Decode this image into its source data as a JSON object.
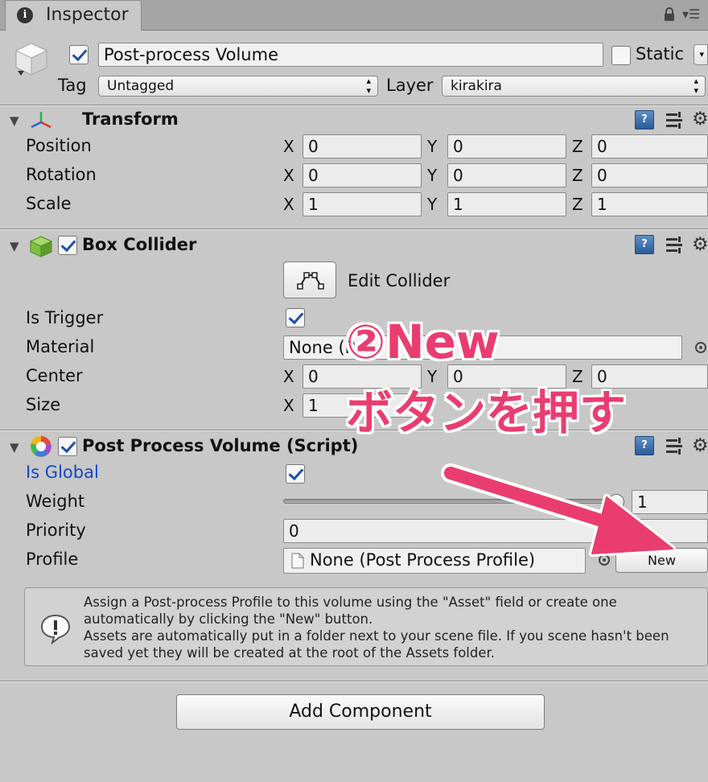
{
  "window": {
    "tab_label": "Inspector"
  },
  "header": {
    "object_name": "Post-process Volume",
    "static_label": "Static",
    "tag_label": "Tag",
    "tag_value": "Untagged",
    "layer_label": "Layer",
    "layer_value": "kirakira"
  },
  "transform": {
    "title": "Transform",
    "rows": [
      {
        "label": "Position",
        "x": "0",
        "y": "0",
        "z": "0"
      },
      {
        "label": "Rotation",
        "x": "0",
        "y": "0",
        "z": "0"
      },
      {
        "label": "Scale",
        "x": "1",
        "y": "1",
        "z": "1"
      }
    ]
  },
  "axes": {
    "x": "X",
    "y": "Y",
    "z": "Z"
  },
  "box_collider": {
    "title": "Box Collider",
    "edit_label": "Edit Collider",
    "is_trigger_label": "Is Trigger",
    "material_label": "Material",
    "material_value": "None (P",
    "center_label": "Center",
    "center": {
      "x": "0",
      "y": "0",
      "z": "0"
    },
    "size_label": "Size",
    "size": {
      "x": "1"
    }
  },
  "post_process_volume": {
    "title": "Post Process Volume (Script)",
    "is_global_label": "Is Global",
    "weight_label": "Weight",
    "weight_value": "1",
    "priority_label": "Priority",
    "priority_value": "0",
    "profile_label": "Profile",
    "profile_value": "None (Post Process Profile)",
    "new_button": "New",
    "help_lines": [
      "Assign a Post-process Profile to this volume using the \"Asset\" field or create one",
      "automatically by clicking the \"New\" button.",
      "Assets are automatically put in a folder next to your scene file. If you scene hasn't been",
      "saved yet they will be created at the root of the Assets folder."
    ]
  },
  "add_component_button": "Add Component",
  "annotation": {
    "line1": "②New",
    "line2": "ボタンを押す",
    "color": "#ea3d6f"
  },
  "icons": {
    "tab": "info-icon",
    "lock": "lock-icon",
    "menu": "menu-icon",
    "help": "help-icon",
    "preset": "preset-icon",
    "gear": "gear-icon",
    "warning": "warning-icon"
  }
}
